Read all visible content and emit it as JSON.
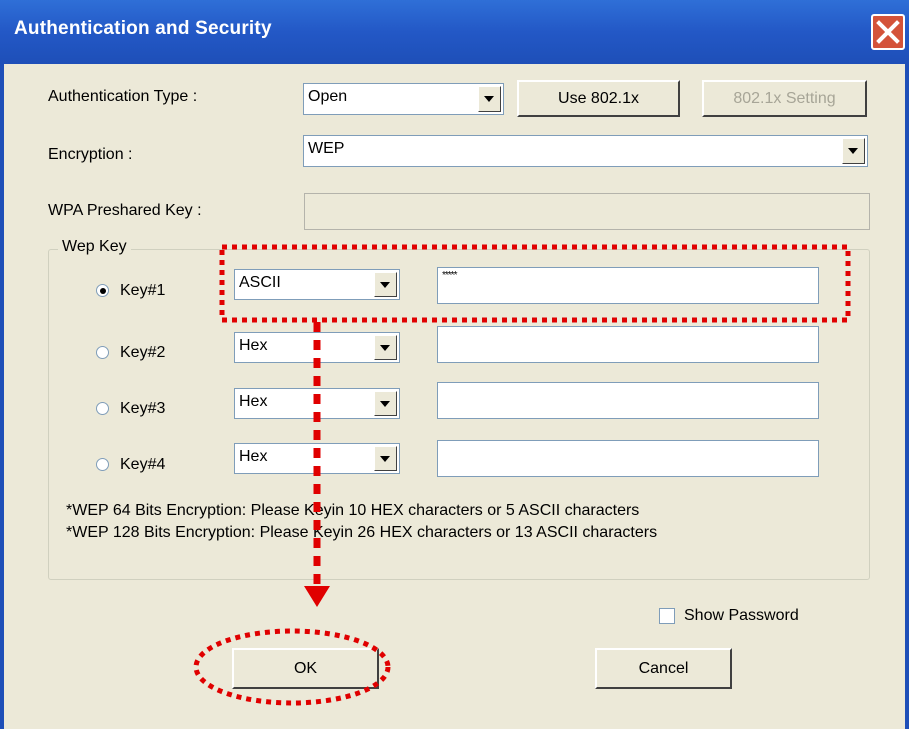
{
  "window": {
    "title": "Authentication and Security"
  },
  "auth": {
    "type_label": "Authentication Type :",
    "type_value": "Open",
    "use8021x_label": "Use 802.1x",
    "setting8021x_label": "802.1x Setting"
  },
  "encryption": {
    "label": "Encryption :",
    "value": "WEP"
  },
  "wpa": {
    "label": "WPA Preshared Key :",
    "value": ""
  },
  "wep": {
    "group_label": "Wep Key",
    "keys": [
      {
        "label": "Key#1",
        "format": "ASCII",
        "value": "*****",
        "selected": true
      },
      {
        "label": "Key#2",
        "format": "Hex",
        "value": "",
        "selected": false
      },
      {
        "label": "Key#3",
        "format": "Hex",
        "value": "",
        "selected": false
      },
      {
        "label": "Key#4",
        "format": "Hex",
        "value": "",
        "selected": false
      }
    ],
    "note1": "*WEP 64 Bits Encryption:  Please Keyin 10 HEX characters or 5 ASCII characters",
    "note2": "*WEP 128 Bits Encryption:  Please Keyin 26 HEX characters or 13 ASCII characters"
  },
  "show_password": {
    "label": "Show Password",
    "checked": false
  },
  "buttons": {
    "ok": "OK",
    "cancel": "Cancel"
  },
  "colors": {
    "highlight": "#E00000",
    "titlebar": "#2358C6",
    "close": "#D4533A"
  }
}
